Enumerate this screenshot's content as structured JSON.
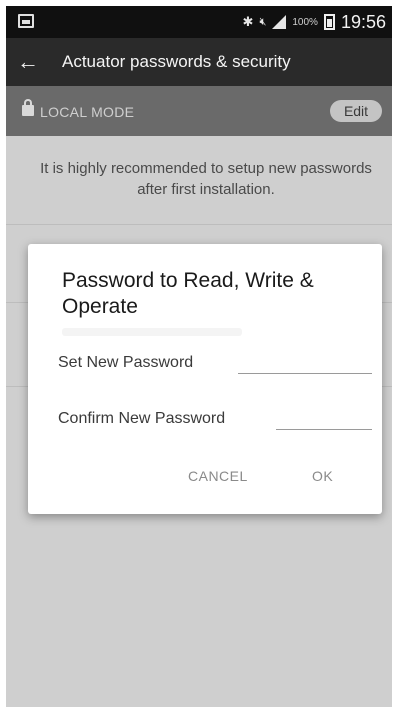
{
  "status_bar": {
    "battery_percent": "100%",
    "time": "19:56",
    "icons": [
      "screenshot-icon",
      "bluetooth-icon",
      "mute-icon",
      "signal-icon",
      "battery-icon"
    ]
  },
  "app_bar": {
    "title": "Actuator passwords & security",
    "back_icon": "arrow-left-icon"
  },
  "mode_bar": {
    "label": "LOCAL MODE",
    "edit_label": "Edit",
    "lock_icon": "lock-icon"
  },
  "content": {
    "recommendation": "It is highly recommended to setup new passwords after first installation."
  },
  "dialog": {
    "title": "Password to Read, Write & Operate",
    "set_password_label": "Set New Password",
    "set_password_value": "",
    "confirm_password_label": "Confirm New Password",
    "confirm_password_value": "",
    "cancel_label": "CANCEL",
    "ok_label": "OK"
  }
}
